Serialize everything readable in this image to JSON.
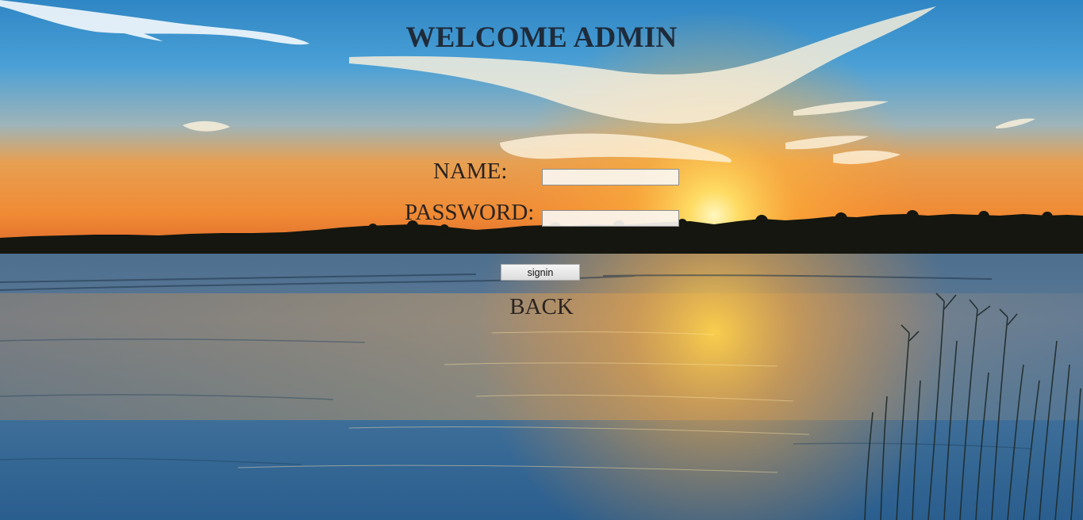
{
  "header": {
    "title": "WELCOME ADMIN"
  },
  "form": {
    "name_label": "NAME:",
    "name_value": "",
    "password_label": "PASSWORD:",
    "password_value": "",
    "signin_label": "signin"
  },
  "back_link": {
    "label": "BACK"
  },
  "background": {
    "description_icon": "lake-sunset-image"
  }
}
